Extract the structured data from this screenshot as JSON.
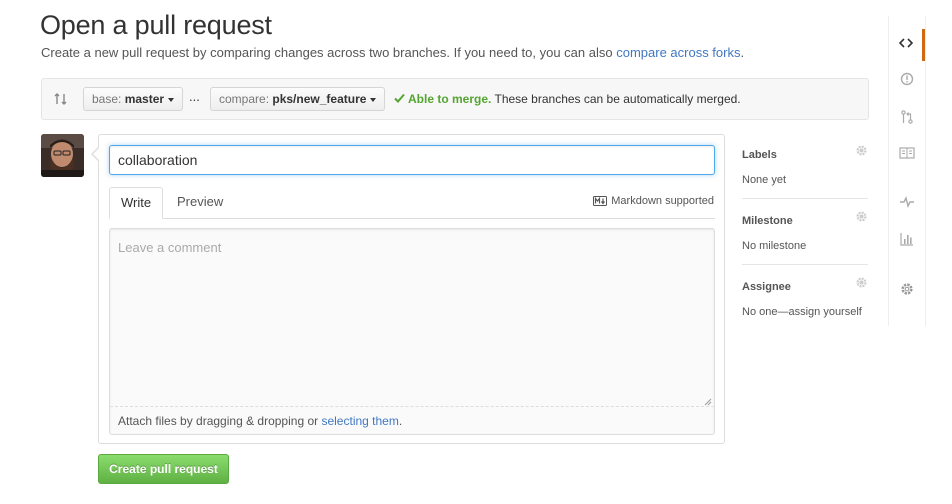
{
  "header": {
    "title": "Open a pull request",
    "subtitle_prefix": "Create a new pull request by comparing changes across two branches. If you need to, you can also ",
    "subtitle_link": "compare across forks",
    "subtitle_suffix": "."
  },
  "range": {
    "base_label": "base:",
    "base_branch": "master",
    "separator": "...",
    "compare_label": "compare:",
    "compare_branch": "pks/new_feature",
    "merge_status": "Able to merge.",
    "merge_message": "These branches can be automatically merged."
  },
  "form": {
    "title_value": "collaboration",
    "tabs": [
      {
        "label": "Write",
        "active": true
      },
      {
        "label": "Preview",
        "active": false
      }
    ],
    "markdown_note": "Markdown supported",
    "comment_placeholder": "Leave a comment",
    "attach_prefix": "Attach files by dragging & dropping or ",
    "attach_link": "selecting them",
    "attach_suffix": ".",
    "submit_label": "Create pull request"
  },
  "sidebar": {
    "labels": {
      "heading": "Labels",
      "value": "None yet"
    },
    "milestone": {
      "heading": "Milestone",
      "value": "No milestone"
    },
    "assignee": {
      "heading": "Assignee",
      "value": "No one—assign yourself"
    }
  },
  "repo_nav": {
    "items": [
      {
        "icon": "code-icon",
        "selected": true
      },
      {
        "icon": "issue-opened-icon",
        "selected": false
      },
      {
        "icon": "pull-request-icon",
        "selected": false
      },
      {
        "icon": "wiki-book-icon",
        "selected": false
      },
      {
        "icon": "pulse-icon",
        "selected": false
      },
      {
        "icon": "graph-icon",
        "selected": false
      },
      {
        "icon": "settings-gear-icon",
        "selected": false
      }
    ]
  },
  "colors": {
    "accent_link": "#4078c0",
    "merge_ok": "#55a532",
    "create_button": "#60b044",
    "nav_selected": "#d26911"
  }
}
